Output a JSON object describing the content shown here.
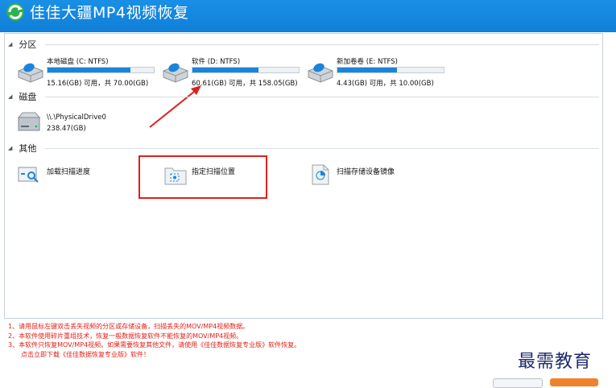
{
  "app": {
    "title": "佳佳大疆MP4视频恢复"
  },
  "sections": {
    "partitions": "分区",
    "disks": "磁盘",
    "other": "其他"
  },
  "partitions": [
    {
      "name": "本地磁盘 (C: NTFS)",
      "size_text": "15.16(GB) 可用，共 70.00(GB)",
      "used_fraction": 0.78
    },
    {
      "name": "软件 (D: NTFS)",
      "size_text": "60.61(GB) 可用，共 158.05(GB)",
      "used_fraction": 0.62
    },
    {
      "name": "新加卷卷 (E: NTFS)",
      "size_text": "4.43(GB) 可用，共 10.00(GB)",
      "used_fraction": 0.56
    }
  ],
  "disks": [
    {
      "name": "\\\\.\\PhysicalDrive0",
      "size_text": "238.47(GB)"
    }
  ],
  "tools": [
    {
      "label": "加载扫描进度"
    },
    {
      "label": "指定扫描位置"
    },
    {
      "label": "扫描存储设备镜像"
    }
  ],
  "notes": [
    "1、请用鼠标左键双击丢失视频的分区或存储设备，扫描丢失的MOV/MP4视频数据。",
    "2、本软件使用碎片重组技术，恢复一般数据恢复软件不能恢复的MOV/MP4视频。",
    "3、本软件只恢复MOV/MP4视频。如果需要恢复其他文件，请使用《佳佳数据恢复专业版》软件恢复。",
    "点击立即下载《佳佳数据恢复专业版》软件！"
  ],
  "watermark": "最需教育",
  "colors": {
    "title_bar": "#1586e0",
    "progress": "#1a84dc",
    "notes_text": "#e02016",
    "highlight": "#e0201a"
  },
  "icons": {
    "drive": "hard-drive-icon",
    "disk": "physical-disk-icon",
    "load": "load-progress-icon",
    "folder": "folder-scan-icon",
    "image": "disk-image-icon"
  }
}
